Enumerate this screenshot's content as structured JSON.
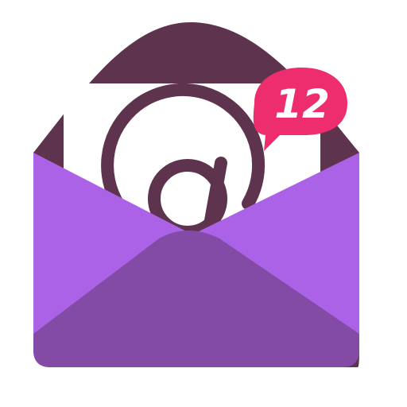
{
  "app_icon": {
    "name": "mail-app-icon",
    "symbol": "@",
    "badge": {
      "count": "12",
      "color": "#ee2d6e",
      "text_color": "#ffffff"
    },
    "colors": {
      "envelope_back": "#5e334d",
      "letter_paper": "#ffffff",
      "at_symbol": "#5e334d",
      "envelope_front_sides": "#ac62e6",
      "envelope_front_bottom": "#834aa6"
    }
  }
}
